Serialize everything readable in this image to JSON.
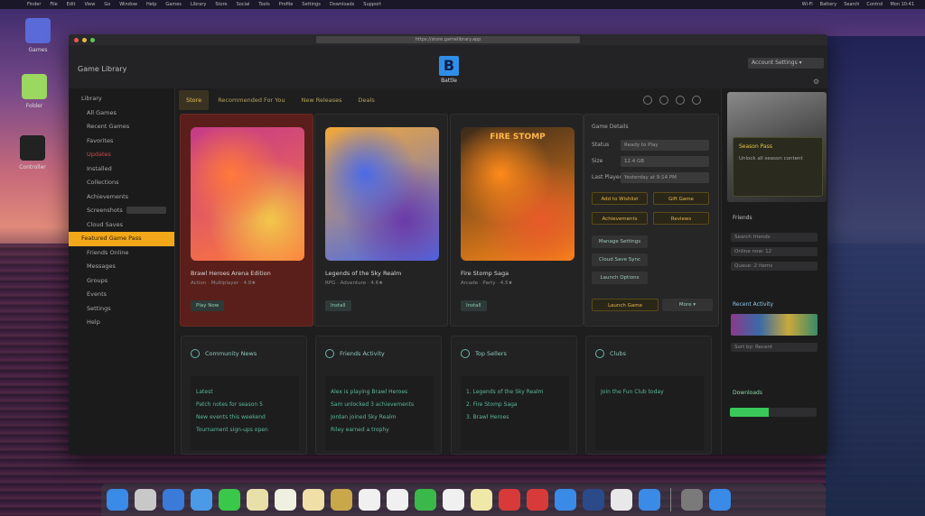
{
  "menubar": {
    "items": [
      "Finder",
      "File",
      "Edit",
      "View",
      "Go",
      "Window",
      "Help",
      "Games",
      "Library",
      "Store",
      "Social",
      "Tools",
      "Profile",
      "Settings",
      "Downloads",
      "Support"
    ],
    "right": [
      "Wi-Fi",
      "Battery",
      "Search",
      "Control",
      "Mon 10:41"
    ]
  },
  "desktop": {
    "icons": [
      "Games",
      "Folder",
      "Controller"
    ]
  },
  "window": {
    "address": "https://store.gamelibrary.app",
    "app_title": "Game Library",
    "logo_mark": "B",
    "logo_name": "Battle",
    "header_dropdown": "Account Settings ▾",
    "header_icon": "⚙"
  },
  "sidebar": {
    "items": [
      {
        "label": "Library",
        "kind": "head"
      },
      {
        "label": "All Games",
        "kind": "sub"
      },
      {
        "label": "Recent Games",
        "kind": "sub"
      },
      {
        "label": "Favorites",
        "kind": "sub"
      },
      {
        "label": "Updates",
        "kind": "red"
      },
      {
        "label": "Installed",
        "kind": "sub"
      },
      {
        "label": "Collections",
        "kind": "sub"
      },
      {
        "label": "Achievements",
        "kind": "sub"
      },
      {
        "label": "Screenshots",
        "kind": "pill"
      },
      {
        "label": "Cloud Saves",
        "kind": "sub"
      },
      {
        "label": "Featured Game Pass",
        "kind": "active"
      },
      {
        "label": "Friends Online",
        "kind": "sub"
      },
      {
        "label": "Messages",
        "kind": "sub"
      },
      {
        "label": "Groups",
        "kind": "sub"
      },
      {
        "label": "Events",
        "kind": "sub"
      },
      {
        "label": "Settings",
        "kind": "sub"
      },
      {
        "label": "Help",
        "kind": "sub"
      }
    ]
  },
  "tabs": [
    "Store",
    "Recommended For You",
    "New Releases",
    "Deals"
  ],
  "cards": [
    {
      "title": "Brawl Heroes Arena Edition",
      "sub": "Action · Multiplayer · 4.8★",
      "btn": "Play Now",
      "palette": [
        "#ff7a3a",
        "#c43a8a",
        "#f2c84a"
      ]
    },
    {
      "title": "Legends of the Sky Realm",
      "sub": "RPG · Adventure · 4.6★",
      "btn": "Install",
      "palette": [
        "#4a6ae8",
        "#f2a83a",
        "#6a3aa8"
      ]
    },
    {
      "title": "Fire Stomp Saga",
      "sub": "Arcade · Party · 4.5★",
      "btn": "Install",
      "palette": [
        "#ff8a1a",
        "#3a2a1a",
        "#e85a2a"
      ]
    }
  ],
  "card_banner": "FIRE STOMP",
  "detail": {
    "heading": "Game Details",
    "rows": [
      {
        "label": "Status",
        "value": "Ready to Play"
      },
      {
        "label": "Size",
        "value": "12.4 GB"
      },
      {
        "label": "Last Played",
        "value": "Yesterday at 9:14 PM"
      }
    ],
    "gold_buttons": [
      "Add to Wishlist",
      "Gift Game",
      "Achievements",
      "Reviews"
    ],
    "dark_buttons": [
      "Manage Settings",
      "Cloud Save Sync",
      "Launch Options"
    ],
    "primary": "Launch Game",
    "secondary": "More ▾"
  },
  "panels": [
    {
      "title": "Community News",
      "lines": [
        "Latest",
        "Patch notes for season 5",
        "New events this weekend",
        "Tournament sign-ups open"
      ]
    },
    {
      "title": "Friends Activity",
      "lines": [
        "Alex is playing Brawl Heroes",
        "Sam unlocked 3 achievements",
        "Jordan joined Sky Realm",
        "Riley earned a trophy"
      ]
    },
    {
      "title": "Top Sellers",
      "lines": [
        "1. Legends of the Sky Realm",
        "2. Fire Stomp Saga",
        "3. Brawl Heroes"
      ]
    },
    {
      "title": "Clubs",
      "lines": [
        "Join the Fun Club today"
      ]
    }
  ],
  "rightcol": {
    "promo_title": "Season Pass",
    "promo_text": "Unlock all season content",
    "labels": [
      "Friends",
      "Recent Activity",
      "Downloads"
    ],
    "fields": [
      "Search friends",
      "Online now: 12",
      "Queue: 2 items",
      "Sort by: Recent"
    ],
    "progress_pct": 0.45
  },
  "dock": {
    "count": 24
  }
}
